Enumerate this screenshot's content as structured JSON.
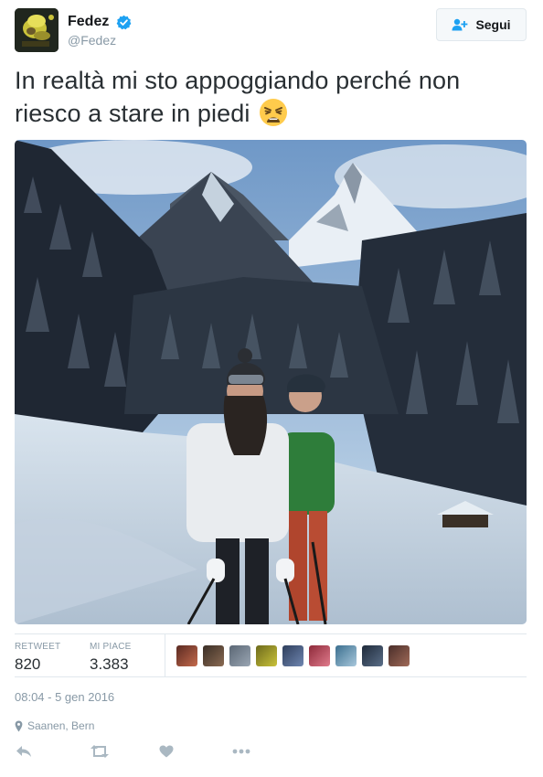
{
  "author": {
    "display_name": "Fedez",
    "handle": "@Fedez",
    "verified": true
  },
  "follow_button": {
    "label": "Segui",
    "icon": "add-user-icon"
  },
  "tweet": {
    "text": "In realtà mi sto appoggiando perché non riesco a stare in piedi",
    "emoji": "weary-face-emoji"
  },
  "stats": {
    "retweet_label": "RETWEET",
    "retweet_count": "820",
    "likes_label": "MI PIACE",
    "likes_count": "3.383"
  },
  "likers_count_shown": 9,
  "timestamp": "08:04 - 5 gen 2016",
  "location": {
    "text": "Saanen, Bern",
    "icon": "location-pin-icon"
  },
  "actions": [
    {
      "name": "reply-icon"
    },
    {
      "name": "retweet-icon"
    },
    {
      "name": "like-icon"
    },
    {
      "name": "more-icon"
    }
  ],
  "colors": {
    "verified_blue": "#1da1f2",
    "muted_text": "#8899a6",
    "body_text": "#292f33",
    "border": "#e1e8ed",
    "action_icon": "#aab8c2"
  }
}
